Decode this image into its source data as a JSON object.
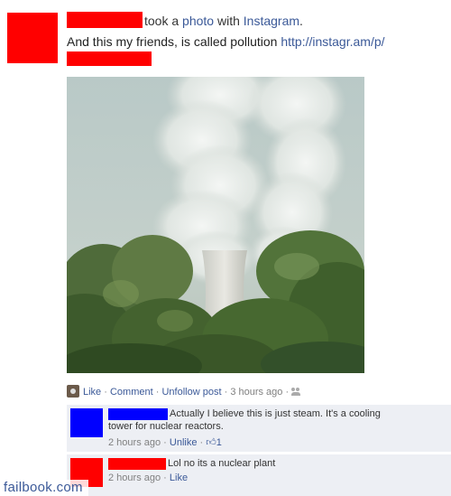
{
  "post": {
    "action_text": "took a ",
    "action_link": "photo",
    "with_text": " with ",
    "app_name": "Instagram",
    "period": ".",
    "message": "And this my friends, is called pollution ",
    "url": "http://instagr.am/p/"
  },
  "actions": {
    "like": "Like",
    "comment": "Comment",
    "unfollow": "Unfollow post",
    "time": "3 hours ago",
    "sep": "·"
  },
  "comments": [
    {
      "line1": "Actually I believe this is just steam. It's a cooling",
      "line2": "tower for nuclear reactors.",
      "time": "2 hours ago",
      "action": "Unlike",
      "like_count": "1"
    },
    {
      "line1": "Lol no its a nuclear plant",
      "time": "2 hours ago",
      "action": "Like"
    }
  ],
  "watermark": "failbook.com",
  "colors": {
    "redaction": "#ff0000",
    "redaction_blue": "#0000ff",
    "link": "#3b5998",
    "comment_bg": "#edeff4"
  }
}
